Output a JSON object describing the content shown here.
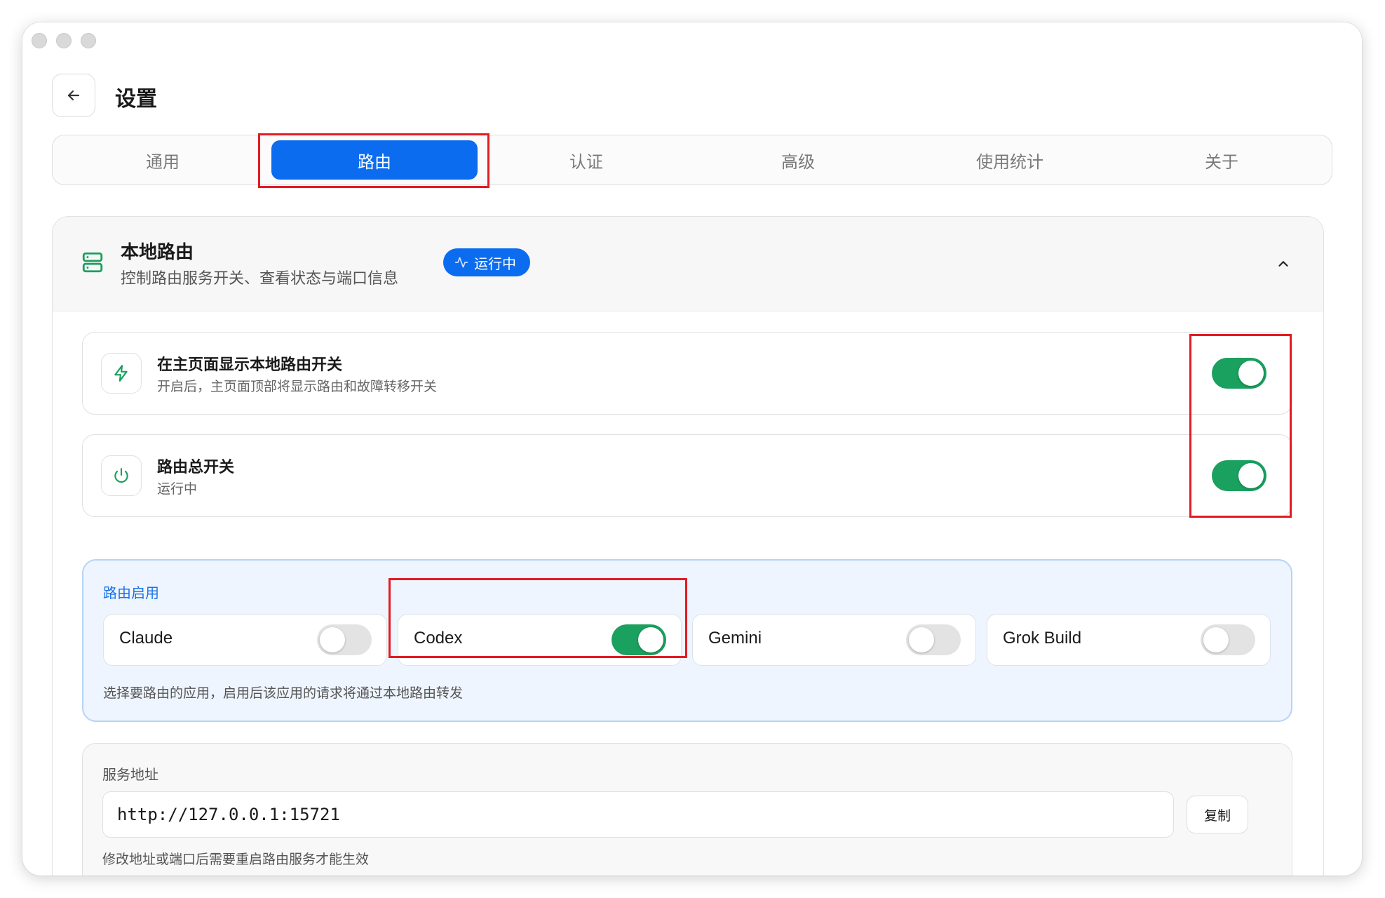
{
  "header": {
    "title": "设置"
  },
  "tabs": [
    {
      "label": "通用"
    },
    {
      "label": "路由"
    },
    {
      "label": "认证"
    },
    {
      "label": "高级"
    },
    {
      "label": "使用统计"
    },
    {
      "label": "关于"
    }
  ],
  "active_tab": "路由",
  "panel": {
    "title": "本地路由",
    "subtitle": "控制路由服务开关、查看状态与端口信息",
    "badge": "运行中",
    "accent_color": "#0b6cf0",
    "success_color": "#1aa05f"
  },
  "settings": [
    {
      "title": "在主页面显示本地路由开关",
      "subtitle": "开启后，主页面顶部将显示路由和故障转移开关",
      "icon": "bolt-icon",
      "enabled": true
    },
    {
      "title": "路由总开关",
      "subtitle": "运行中",
      "icon": "power-icon",
      "enabled": true
    }
  ],
  "apps": {
    "label": "路由启用",
    "items": [
      {
        "name": "Claude",
        "enabled": false
      },
      {
        "name": "Codex",
        "enabled": true
      },
      {
        "name": "Gemini",
        "enabled": false
      },
      {
        "name": "Grok Build",
        "enabled": false
      }
    ],
    "hint": "选择要路由的应用，启用后该应用的请求将通过本地路由转发"
  },
  "address": {
    "label": "服务地址",
    "value": "http://127.0.0.1:15721",
    "copy_label": "复制",
    "hint": "修改地址或端口后需要重启路由服务才能生效"
  }
}
